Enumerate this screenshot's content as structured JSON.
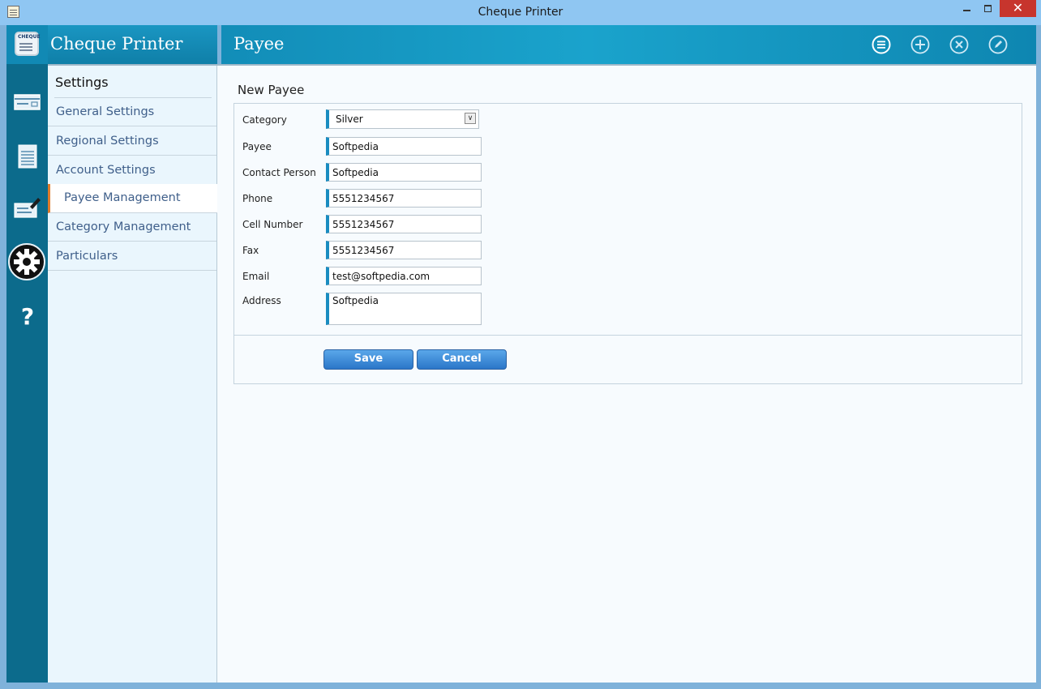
{
  "window": {
    "title": "Cheque Printer",
    "close_glyph": "✕"
  },
  "app": {
    "name": "Cheque Printer",
    "logo_text": "CHEQUE"
  },
  "header": {
    "page_title": "Payee",
    "actions": [
      "list-icon",
      "add-icon",
      "delete-icon",
      "edit-icon"
    ]
  },
  "rail": {
    "icons": [
      "cheque-icon",
      "report-icon",
      "cheque-edit-icon",
      "settings-gear-icon",
      "help-icon"
    ]
  },
  "menu": {
    "title": "Settings",
    "items": [
      {
        "label": "General Settings"
      },
      {
        "label": "Regional Settings"
      },
      {
        "label": "Account Settings"
      },
      {
        "label": "Payee Management"
      },
      {
        "label": "Category Management"
      },
      {
        "label": "Particulars"
      }
    ],
    "active_index": 3
  },
  "form": {
    "title": "New Payee",
    "fields": {
      "category": {
        "label": "Category",
        "value": "Silver"
      },
      "payee": {
        "label": "Payee",
        "value": "Softpedia"
      },
      "contact_person": {
        "label": "Contact Person",
        "value": "Softpedia"
      },
      "phone": {
        "label": "Phone",
        "value": "5551234567"
      },
      "cell_number": {
        "label": "Cell Number",
        "value": "5551234567"
      },
      "fax": {
        "label": "Fax",
        "value": "5551234567"
      },
      "email": {
        "label": "Email",
        "value": "test@softpedia.com"
      },
      "address": {
        "label": "Address",
        "value": "Softpedia"
      }
    },
    "save_label": "Save",
    "cancel_label": "Cancel"
  },
  "colors": {
    "accent": "#1a8cc0",
    "rail": "#0c6b8c",
    "active_marker": "#e07b2a"
  }
}
